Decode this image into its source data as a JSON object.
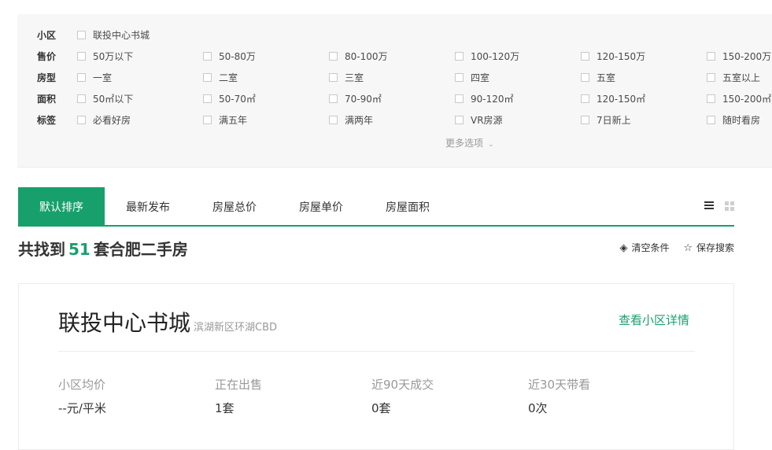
{
  "filters": [
    {
      "label": "小区",
      "options": [
        "联投中心书城"
      ]
    },
    {
      "label": "售价",
      "options": [
        "50万以下",
        "50-80万",
        "80-100万",
        "100-120万",
        "120-150万",
        "150-200万"
      ]
    },
    {
      "label": "房型",
      "options": [
        "一室",
        "二室",
        "三室",
        "四室",
        "五室",
        "五室以上"
      ]
    },
    {
      "label": "面积",
      "options": [
        "50㎡以下",
        "50-70㎡",
        "70-90㎡",
        "90-120㎡",
        "120-150㎡",
        "150-200㎡"
      ]
    },
    {
      "label": "标签",
      "options": [
        "必看好房",
        "满五年",
        "满两年",
        "VR房源",
        "7日新上",
        "随时看房"
      ]
    }
  ],
  "more_options": "更多选项",
  "tabs": [
    "默认排序",
    "最新发布",
    "房屋总价",
    "房屋单价",
    "房屋面积"
  ],
  "active_tab": 0,
  "result": {
    "prefix": "共找到",
    "count": "51",
    "suffix": "套合肥二手房"
  },
  "actions": {
    "clear": "清空条件",
    "save": "保存搜索"
  },
  "community": {
    "name": "联投中心书城",
    "area": "滨湖新区环湖CBD",
    "detail_link": "查看小区详情",
    "stats": [
      {
        "label": "小区均价",
        "value": "--元/平米"
      },
      {
        "label": "正在出售",
        "value": "1套"
      },
      {
        "label": "近90天成交",
        "value": "0套"
      },
      {
        "label": "近30天带看",
        "value": "0次"
      }
    ]
  },
  "colors": {
    "accent": "#17a06c"
  }
}
